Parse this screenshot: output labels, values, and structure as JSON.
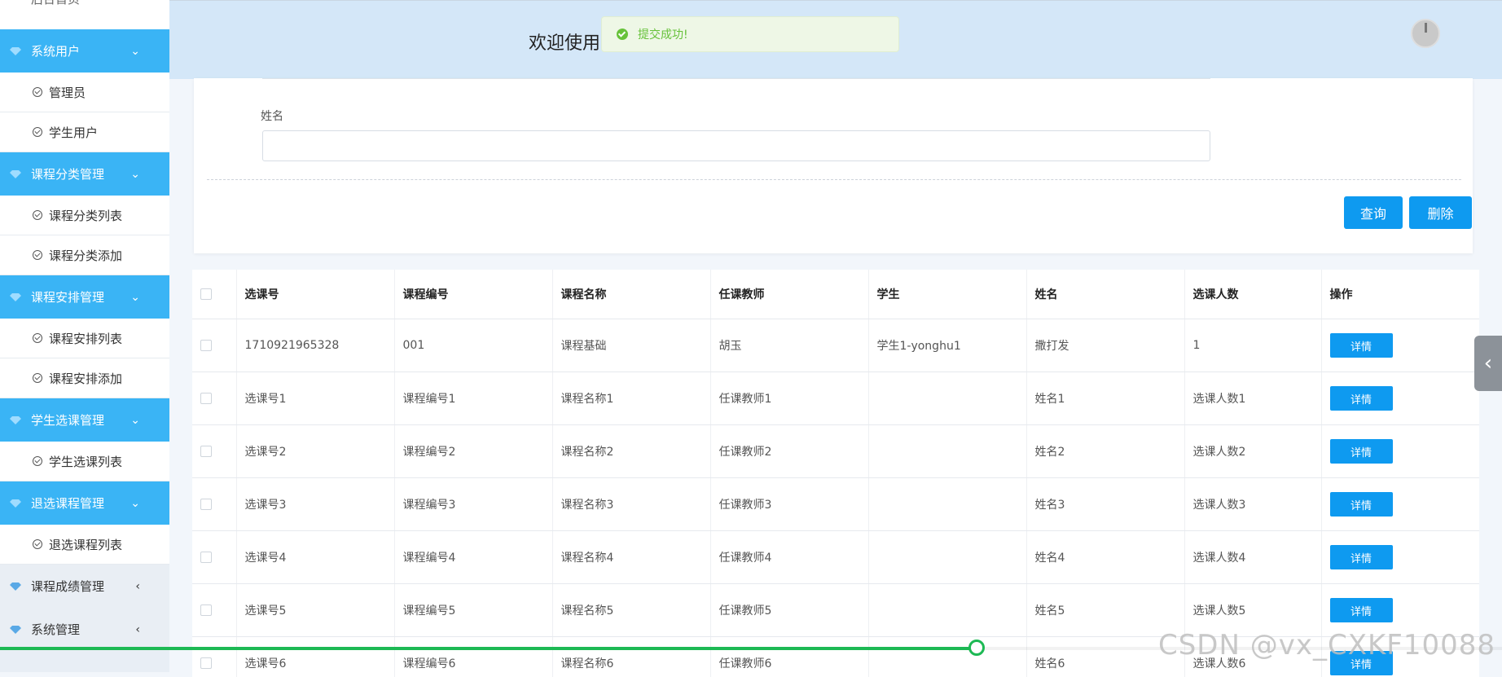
{
  "sidebar": {
    "top_item": "后台首页",
    "groups": [
      {
        "label": "系统用户",
        "items": [
          "管理员",
          "学生用户"
        ]
      },
      {
        "label": "课程分类管理",
        "items": [
          "课程分类列表",
          "课程分类添加"
        ]
      },
      {
        "label": "课程安排管理",
        "items": [
          "课程安排列表",
          "课程安排添加"
        ]
      },
      {
        "label": "学生选课管理",
        "items": [
          "学生选课列表"
        ]
      },
      {
        "label": "退选课程管理",
        "items": [
          "退选课程列表"
        ]
      },
      {
        "label": "课程成绩管理",
        "items": []
      },
      {
        "label": "系统管理",
        "items": []
      }
    ]
  },
  "header": {
    "welcome": "欢迎使用"
  },
  "toast": {
    "message": "提交成功!"
  },
  "search": {
    "field_label": "姓名",
    "field_value": "",
    "query_button": "查询",
    "delete_button": "删除"
  },
  "table": {
    "columns": [
      "选课号",
      "课程编号",
      "课程名称",
      "任课教师",
      "学生",
      "姓名",
      "选课人数",
      "操作"
    ],
    "detail_button": "详情",
    "rows": [
      [
        "1710921965328",
        "001",
        "课程基础",
        "胡玉",
        "学生1-yonghu1",
        "撒打发",
        "1"
      ],
      [
        "选课号1",
        "课程编号1",
        "课程名称1",
        "任课教师1",
        "",
        "姓名1",
        "选课人数1"
      ],
      [
        "选课号2",
        "课程编号2",
        "课程名称2",
        "任课教师2",
        "",
        "姓名2",
        "选课人数2"
      ],
      [
        "选课号3",
        "课程编号3",
        "课程名称3",
        "任课教师3",
        "",
        "姓名3",
        "选课人数3"
      ],
      [
        "选课号4",
        "课程编号4",
        "课程名称4",
        "任课教师4",
        "",
        "姓名4",
        "选课人数4"
      ],
      [
        "选课号5",
        "课程编号5",
        "课程名称5",
        "任课教师5",
        "",
        "姓名5",
        "选课人数5"
      ],
      [
        "选课号6",
        "课程编号6",
        "课程名称6",
        "任课教师6",
        "",
        "姓名6",
        "选课人数6"
      ]
    ]
  },
  "video": {
    "progress": 0.65
  },
  "watermark": "CSDN @vx_CXKF10088",
  "colors": {
    "accent": "#0e9af0",
    "sidebar_active": "#3ab4f5",
    "success": "#67c23a",
    "progress": "#1db954"
  }
}
